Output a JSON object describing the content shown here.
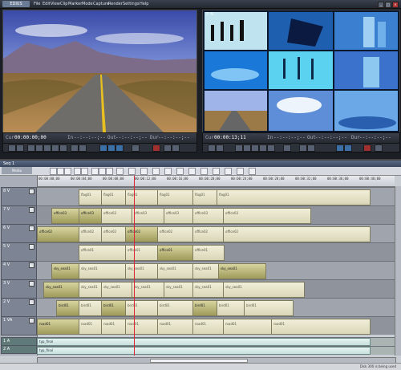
{
  "app": {
    "logo": "EDIUS",
    "menus": [
      "File",
      "Edit",
      "View",
      "Clip",
      "Marker",
      "Mode",
      "Capture",
      "Render",
      "Settings",
      "Help"
    ]
  },
  "player": {
    "label": "Cur",
    "timecode": "00:00:00;00",
    "in_label": "In",
    "in_tc": "--:--:--;--",
    "out_label": "Out",
    "out_tc": "--:--:--;--",
    "dur_label": "Dur",
    "dur_tc": "--:--:--;--"
  },
  "recorder": {
    "label": "Cur",
    "timecode": "00:00:13;11",
    "in_label": "In",
    "in_tc": "--:--:--;--",
    "out_label": "Out",
    "out_tc": "--:--:--;--",
    "dur_label": "Dur",
    "dur_tc": "--:--:--;--"
  },
  "timeline": {
    "window_title": "Seq 1",
    "tab": "Media",
    "ruler_ticks": [
      "00:00:00;00",
      "00:00:04;00",
      "00:00:08;00",
      "00:00:12;00",
      "00:00:16;00",
      "00:00:20;00",
      "00:00:24;00",
      "00:00:28;00",
      "00:00:32;00",
      "00:00:36;00",
      "00:00:40;00"
    ],
    "tracks": [
      {
        "name": "8 V",
        "clips": [
          {
            "label": "flag01"
          },
          {
            "label": "flag01"
          },
          {
            "label": "flag01"
          },
          {
            "label": "flag01"
          },
          {
            "label": "flag01"
          },
          {
            "label": "flag01"
          }
        ]
      },
      {
        "name": "7 V",
        "clips": [
          {
            "label": "office03"
          },
          {
            "label": "office03"
          },
          {
            "label": "office03"
          },
          {
            "label": "office03"
          },
          {
            "label": "office03"
          },
          {
            "label": "office03"
          },
          {
            "label": "office03"
          }
        ]
      },
      {
        "name": "6 V",
        "clips": [
          {
            "label": "office02"
          },
          {
            "label": "office02"
          },
          {
            "label": "office02"
          },
          {
            "label": "office02"
          },
          {
            "label": "office02"
          },
          {
            "label": "office02"
          },
          {
            "label": "office02"
          }
        ]
      },
      {
        "name": "5 V",
        "clips": [
          {
            "label": "office01"
          },
          {
            "label": "office01"
          },
          {
            "label": "office01"
          },
          {
            "label": "office01"
          }
        ]
      },
      {
        "name": "4 V",
        "clips": [
          {
            "label": "sky_sea01"
          },
          {
            "label": "sky_sea01"
          },
          {
            "label": "sky_sea01"
          },
          {
            "label": "sky_sea01"
          },
          {
            "label": "sky_sea01"
          },
          {
            "label": "sky_sea01"
          }
        ]
      },
      {
        "name": "3 V",
        "clips": [
          {
            "label": "sky_sea01"
          },
          {
            "label": "sky_sea01"
          },
          {
            "label": "sky_sea01"
          },
          {
            "label": "sky_sea01"
          },
          {
            "label": "sky_sea01"
          },
          {
            "label": "sky_sea01"
          },
          {
            "label": "sky_sea01"
          }
        ]
      },
      {
        "name": "2 V",
        "clips": [
          {
            "label": "bird01"
          },
          {
            "label": "bird01"
          },
          {
            "label": "bird01"
          },
          {
            "label": "bird01"
          },
          {
            "label": "bird01"
          },
          {
            "label": "bird01"
          },
          {
            "label": "bird01"
          },
          {
            "label": "bird01"
          }
        ]
      },
      {
        "name": "1 VA",
        "clips": [
          {
            "label": "road01"
          },
          {
            "label": "road01"
          },
          {
            "label": "road01"
          },
          {
            "label": "road01"
          },
          {
            "label": "road01"
          },
          {
            "label": "road01"
          },
          {
            "label": "road01"
          },
          {
            "label": "road01"
          }
        ]
      }
    ],
    "audio_tracks": [
      {
        "name": "1 A",
        "label": "typ_final"
      },
      {
        "name": "2 A",
        "label": "typ_final"
      }
    ],
    "status": "Disk 300 is being used"
  },
  "colors": {
    "accent": "#3b6fa5",
    "record": "#a03030"
  }
}
